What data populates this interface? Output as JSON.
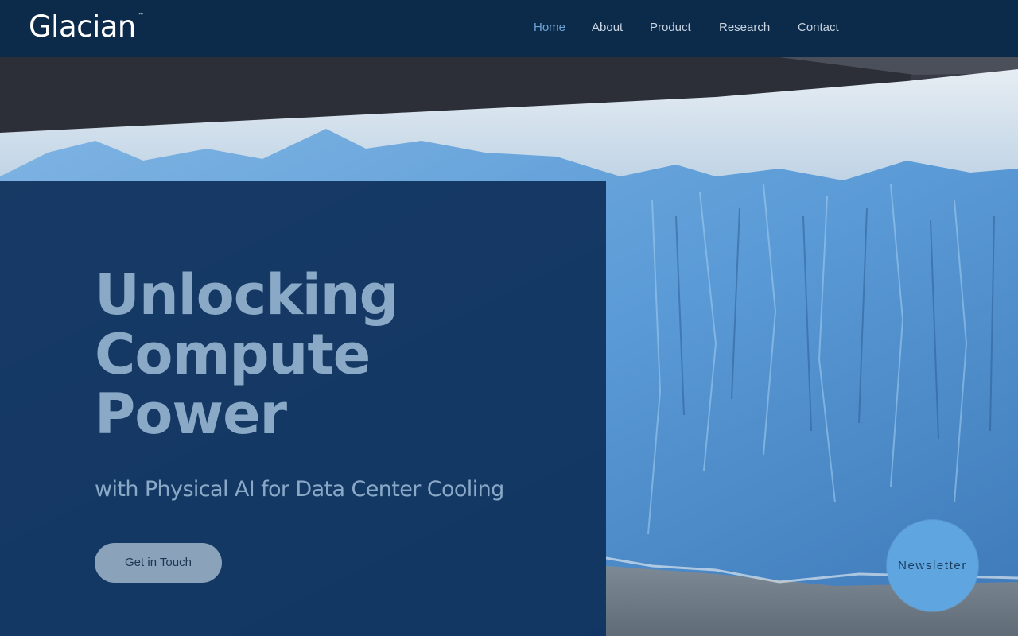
{
  "brand": {
    "name": "Glacian",
    "trademark": "™"
  },
  "nav": {
    "items": [
      {
        "label": "Home",
        "active": true
      },
      {
        "label": "About",
        "active": false
      },
      {
        "label": "Product",
        "active": false
      },
      {
        "label": "Research",
        "active": false
      },
      {
        "label": "Contact",
        "active": false
      }
    ]
  },
  "hero": {
    "headline_lines": [
      "Unlocking",
      "Compute",
      "Power"
    ],
    "subheadline": "with Physical AI for Data Center Cooling",
    "cta_label": "Get in Touch",
    "background": "glacier-photo"
  },
  "newsletter": {
    "label": "Newsletter"
  },
  "colors": {
    "header_bg": "#0c2a4a",
    "panel_bg": "#0e305a",
    "headline_text": "#8aa9c7",
    "nav_active": "#6fa3d6",
    "nav_text": "#c9d5e2",
    "cta_bg": "#8aa3bb",
    "newsletter_bg": "#5fa5e0"
  }
}
